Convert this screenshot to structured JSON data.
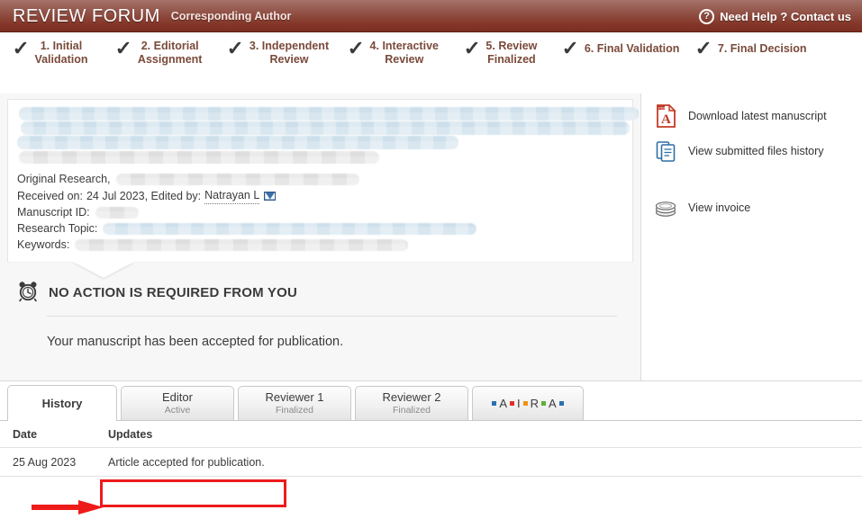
{
  "header": {
    "brand": "REVIEW FORUM",
    "role": "Corresponding Author",
    "help_label": "Need Help ? Contact us",
    "help_icon": "question-mark-circle-icon",
    "gradient_top": "#a4726a",
    "gradient_bottom": "#7a2d20"
  },
  "stepper": {
    "steps": [
      {
        "label": "1. Initial\nValidation",
        "check": "✓",
        "completed": true
      },
      {
        "label": "2. Editorial\nAssignment",
        "check": "✓",
        "completed": true
      },
      {
        "label": "3. Independent\nReview",
        "check": "✓",
        "completed": true
      },
      {
        "label": "4. Interactive\nReview",
        "check": "✓",
        "completed": true
      },
      {
        "label": "5. Review\nFinalized",
        "check": "✓",
        "completed": true
      },
      {
        "label": "6. Final Validation",
        "check": "✓",
        "completed": true
      },
      {
        "label": "7. Final Decision",
        "check": "✓",
        "completed": true
      }
    ],
    "node_color": "#8d8580",
    "line_color": "#5a2a1d",
    "label_color": "#7a4a3a"
  },
  "manuscript": {
    "title_redacted": true,
    "type_line_label": "Original Research,",
    "received_label": "Received on:",
    "received_date": "24 Jul 2023",
    "edited_by_label": ", Edited by:",
    "editor_name": "Natrayan L",
    "editor_mail_icon": "envelope-icon",
    "manuscript_id_label": "Manuscript ID:",
    "manuscript_id_value": "",
    "research_topic_label": "Research Topic:",
    "research_topic_value": "",
    "keywords_label": "Keywords:",
    "keywords_value": ""
  },
  "side_links": [
    {
      "label": "Download latest manuscript",
      "icon": "pdf-file-icon"
    },
    {
      "label": "View submitted files history",
      "icon": "documents-stack-icon"
    },
    {
      "label": "View invoice",
      "icon": "coins-icon"
    }
  ],
  "action": {
    "icon": "alarm-clock-icon",
    "title": "NO ACTION IS REQUIRED FROM YOU",
    "message": "Your manuscript has been accepted for publication."
  },
  "tabs": [
    {
      "label": "History",
      "status": "",
      "active": true
    },
    {
      "label": "Editor",
      "status": "Active",
      "active": false
    },
    {
      "label": "Reviewer 1",
      "status": "Finalized",
      "active": false
    },
    {
      "label": "Reviewer 2",
      "status": "Finalized",
      "active": false
    },
    {
      "label": "AIRA",
      "status": "",
      "active": false,
      "is_aira": true
    }
  ],
  "aira_letters": [
    {
      "square": "#2a6fb5",
      "letter": "A"
    },
    {
      "square": "#e03127",
      "letter": "I"
    },
    {
      "square": "#f0920b",
      "letter": "R"
    },
    {
      "square": "#5fae34",
      "letter": "A"
    },
    {
      "square": "#2a6fb5",
      "letter": ""
    }
  ],
  "history_table": {
    "columns": [
      "Date",
      "Updates"
    ],
    "rows": [
      {
        "date": "25 Aug 2023",
        "update": "Article accepted for publication."
      }
    ]
  },
  "annotations": {
    "highlight_color": "#ee1b1b",
    "arrow_color": "#ee1b1b",
    "highlighted_text": "Article accepted for publication."
  }
}
